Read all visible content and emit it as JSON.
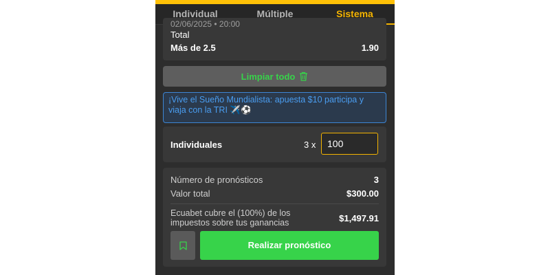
{
  "tabs": [
    {
      "label": "Individual",
      "active": false
    },
    {
      "label": "Múltiple",
      "active": false
    },
    {
      "label": "Sistema",
      "active": true
    }
  ],
  "bet": {
    "date_partial": "02/06/2025 • 20:00",
    "market": "Total",
    "selection": "Más de 2.5",
    "odds": "1.90"
  },
  "clear_button": {
    "label": "Limpiar todo",
    "icon": "trash-icon"
  },
  "promo": {
    "text": "¡Vive el Sueño Mundialista: apuesta $10 participa y viaja con la TRI ✈️⚽"
  },
  "singles": {
    "label": "Individuales",
    "multiplier": "3 x",
    "stake_value": "100"
  },
  "summary": {
    "predictions_label": "Número de pronósticos",
    "predictions_value": "3",
    "total_label": "Valor total",
    "total_value": "$300.00",
    "tax_label": "Ecuabet cubre el (100%) de los impuestos sobre tus ganancias",
    "tax_value": "$1,497.91"
  },
  "actions": {
    "bookmark_icon": "bookmark-icon",
    "place_label": "Realizar pronóstico"
  },
  "colors": {
    "accent": "#f5b400",
    "green": "#37d34a",
    "panel": "#2d2d2d",
    "promo_blue": "#4a9df0"
  }
}
